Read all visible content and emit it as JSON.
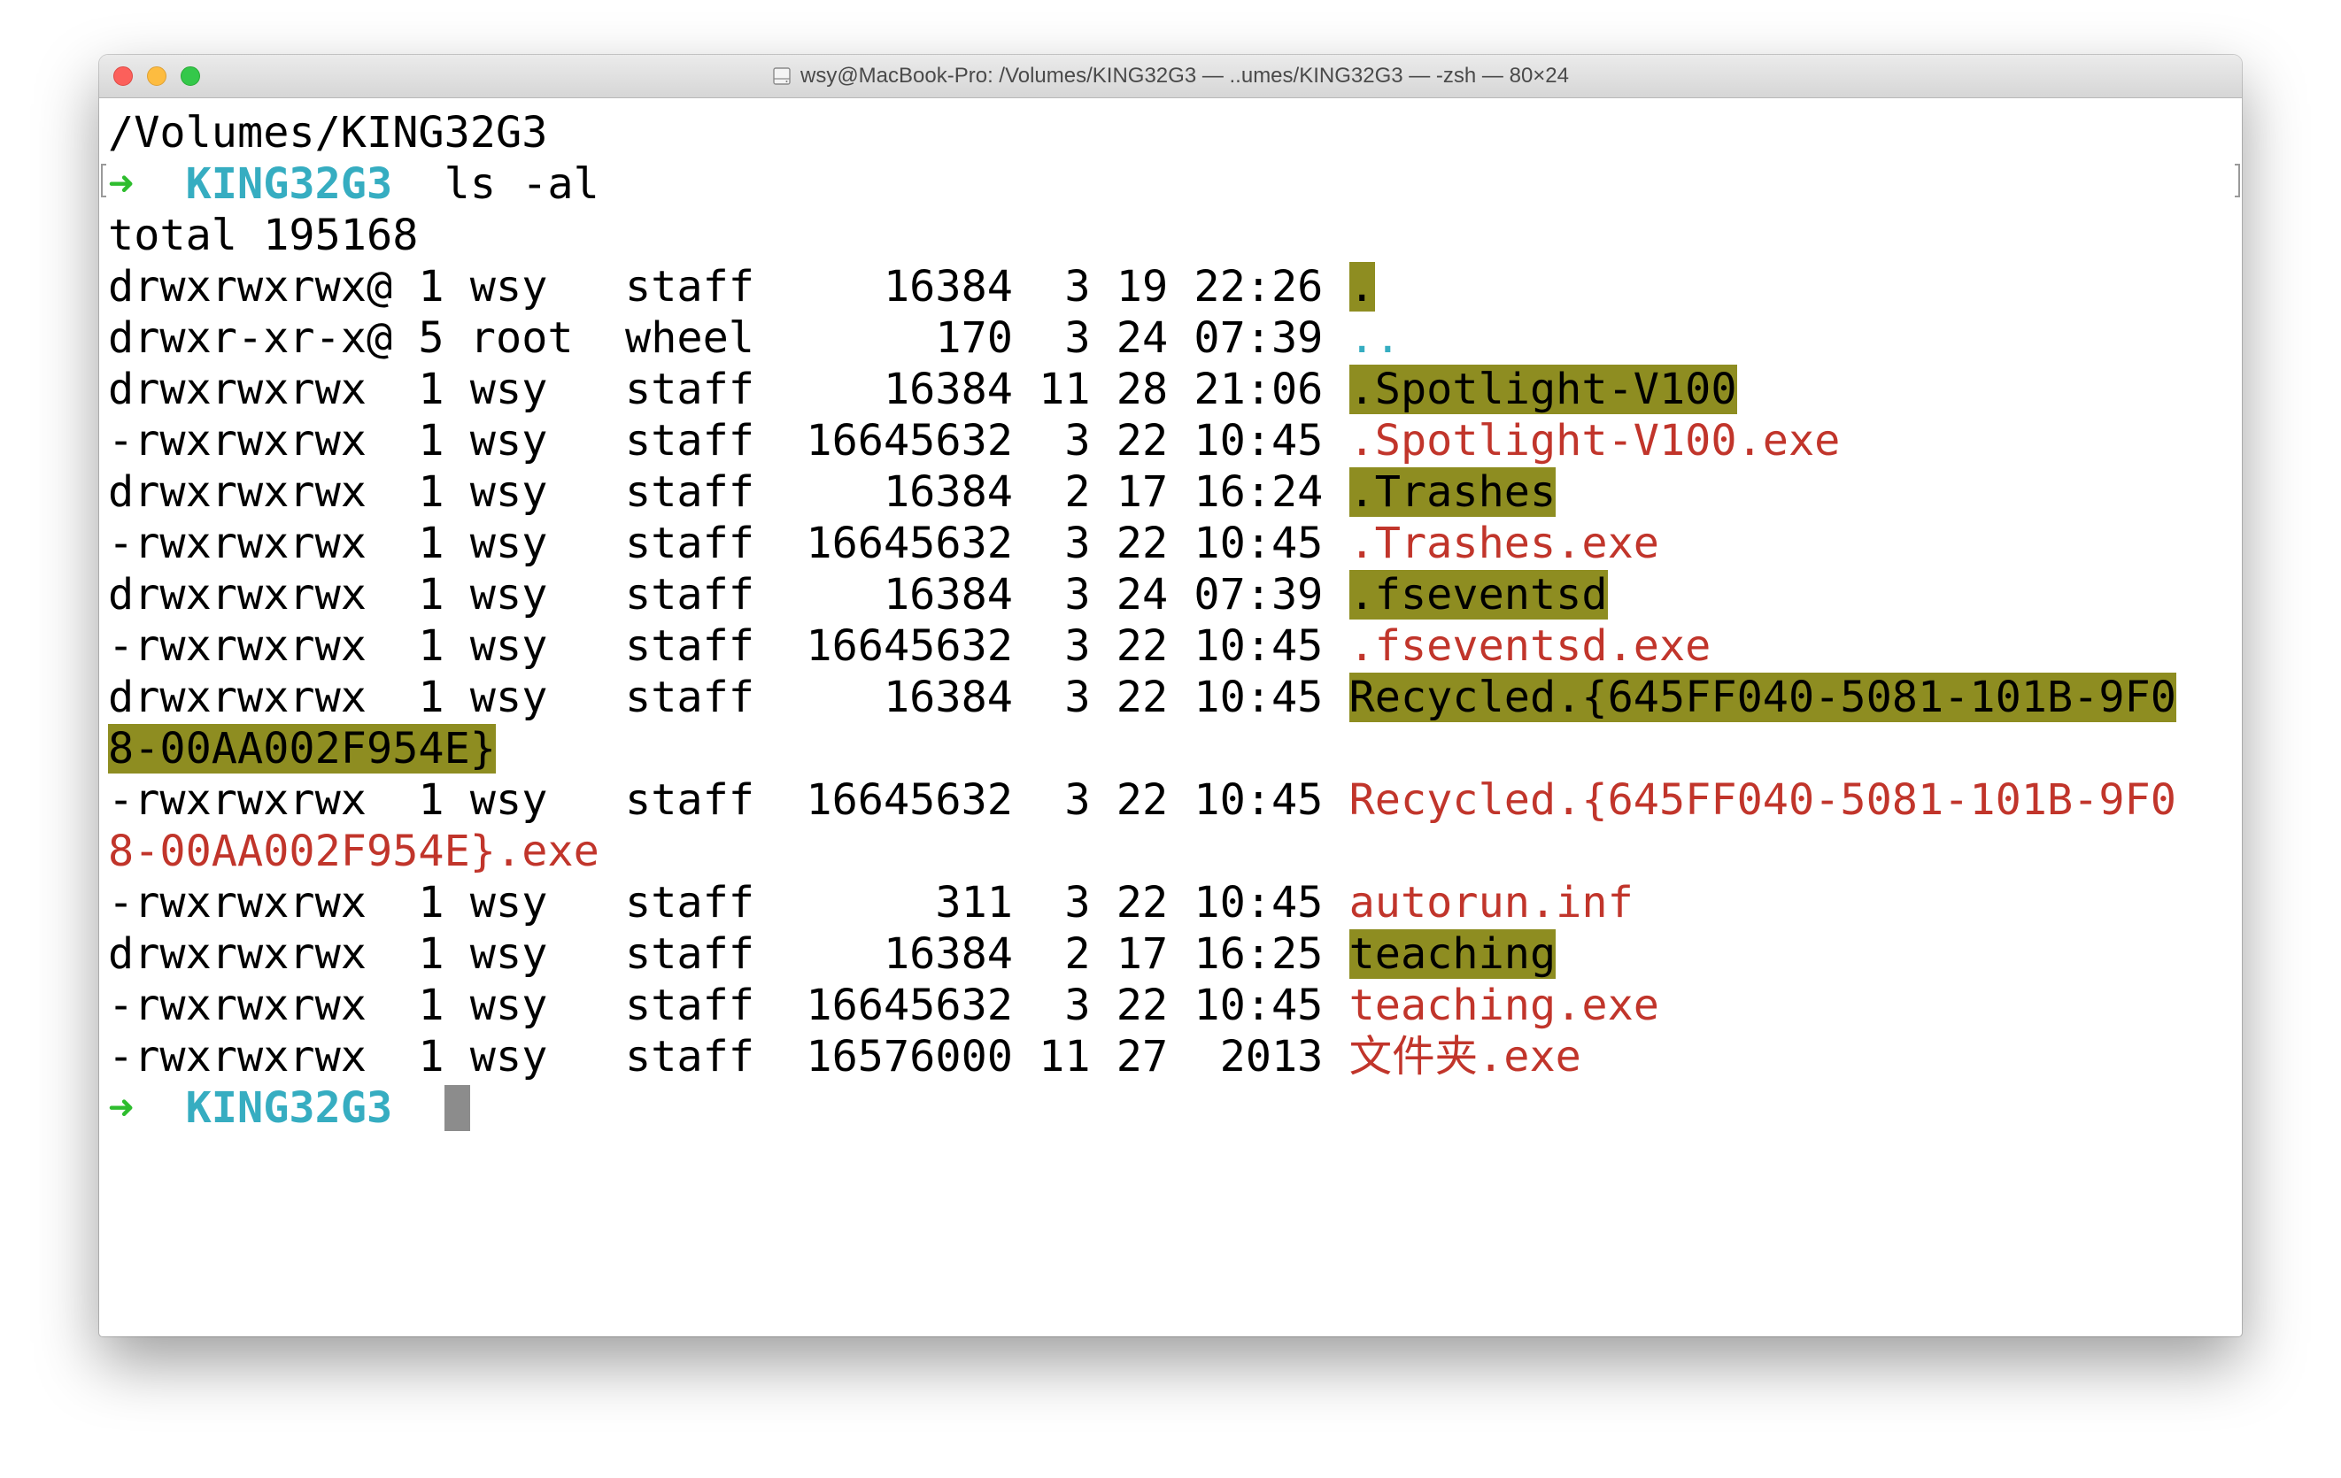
{
  "window": {
    "title": "wsy@MacBook-Pro: /Volumes/KING32G3 — ..umes/KING32G3 — -zsh — 80×24"
  },
  "terminal": {
    "cwd_line": "/Volumes/KING32G3",
    "prompt_arrow": "➜",
    "prompt_dir": "KING32G3",
    "command": "ls -al",
    "total": "total 195168",
    "entries": [
      {
        "meta": "drwxrwxrwx@ 1 wsy   staff     16384  3 19 22:26 ",
        "name": ".",
        "style": "dir"
      },
      {
        "meta": "drwxr-xr-x@ 5 root  wheel       170  3 24 07:39 ",
        "name": "..",
        "style": "cyan"
      },
      {
        "meta": "drwxrwxrwx  1 wsy   staff     16384 11 28 21:06 ",
        "name": ".Spotlight-V100",
        "style": "dir"
      },
      {
        "meta": "-rwxrwxrwx  1 wsy   staff  16645632  3 22 10:45 ",
        "name": ".Spotlight-V100.exe",
        "style": "exe"
      },
      {
        "meta": "drwxrwxrwx  1 wsy   staff     16384  2 17 16:24 ",
        "name": ".Trashes",
        "style": "dir"
      },
      {
        "meta": "-rwxrwxrwx  1 wsy   staff  16645632  3 22 10:45 ",
        "name": ".Trashes.exe",
        "style": "exe"
      },
      {
        "meta": "drwxrwxrwx  1 wsy   staff     16384  3 24 07:39 ",
        "name": ".fseventsd",
        "style": "dir"
      },
      {
        "meta": "-rwxrwxrwx  1 wsy   staff  16645632  3 22 10:45 ",
        "name": ".fseventsd.exe",
        "style": "exe"
      },
      {
        "meta": "drwxrwxrwx  1 wsy   staff     16384  3 22 10:45 ",
        "name": "Recycled.{645FF040-5081-101B-9F0",
        "style": "dir",
        "wrap": "8-00AA002F954E}"
      },
      {
        "meta": "-rwxrwxrwx  1 wsy   staff  16645632  3 22 10:45 ",
        "name": "Recycled.{645FF040-5081-101B-9F0",
        "style": "exe",
        "wrap": "8-00AA002F954E}.exe"
      },
      {
        "meta": "-rwxrwxrwx  1 wsy   staff       311  3 22 10:45 ",
        "name": "autorun.inf",
        "style": "exe"
      },
      {
        "meta": "drwxrwxrwx  1 wsy   staff     16384  2 17 16:25 ",
        "name": "teaching",
        "style": "dir"
      },
      {
        "meta": "-rwxrwxrwx  1 wsy   staff  16645632  3 22 10:45 ",
        "name": "teaching.exe",
        "style": "exe"
      },
      {
        "meta": "-rwxrwxrwx  1 wsy   staff  16576000 11 27  2013 ",
        "name": "文件夹.exe",
        "style": "exe"
      }
    ]
  },
  "icons": {
    "drive": "external-drive-icon"
  },
  "colors": {
    "prompt_arrow": "#2ebd2e",
    "prompt_dir": "#36adc1",
    "dir_highlight": "#8e8d21",
    "exe_text": "#c1352b",
    "cursor": "#8c8c8c"
  }
}
